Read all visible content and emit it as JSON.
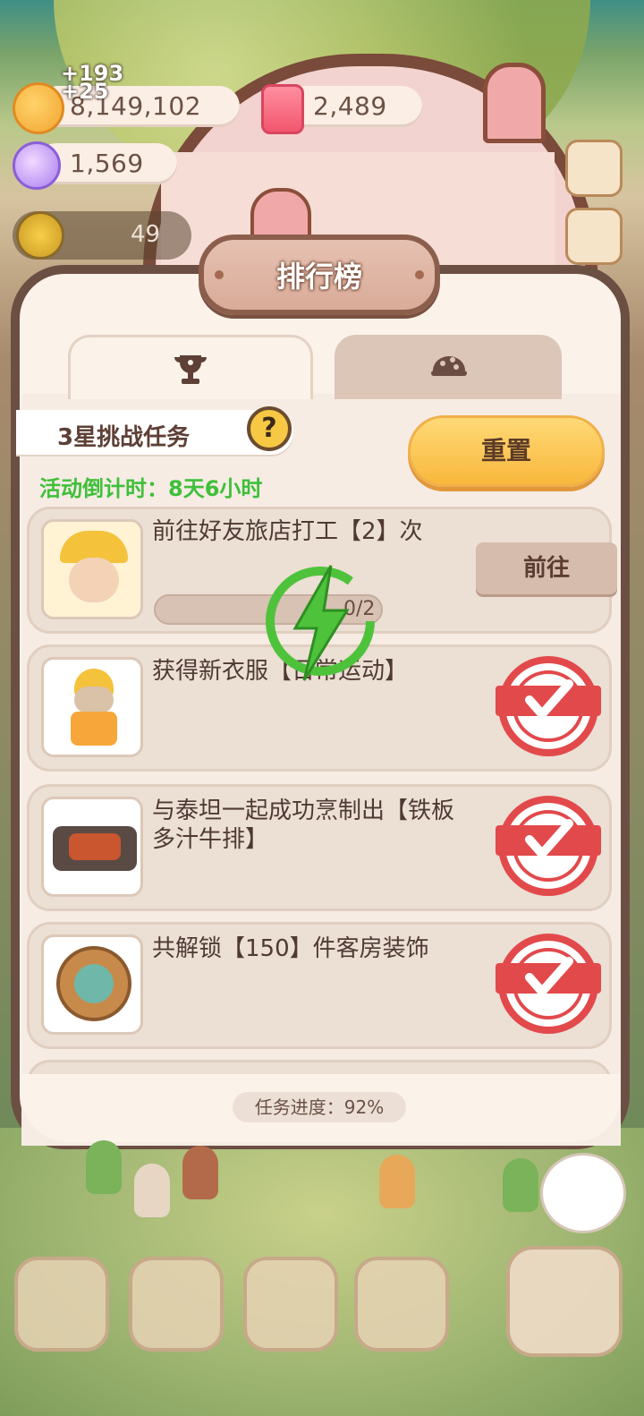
{
  "resources": {
    "cookies": {
      "value": "8,149,102",
      "icon": "cookie-icon"
    },
    "cookie_gain_1": "+193",
    "cookie_gain_2": "+25",
    "candles": {
      "value": "2,489",
      "icon": "candle-icon"
    },
    "gems": {
      "value": "1,569",
      "icon": "gem-icon"
    },
    "level": "49"
  },
  "panel": {
    "title": "排行榜",
    "tabs": [
      {
        "icon": "trophy-icon",
        "active": true
      },
      {
        "icon": "world-icon",
        "active": false
      }
    ],
    "challenge_label": "3星挑战任务",
    "help_label": "?",
    "countdown": "活动倒计时：8天6小时",
    "reset_label": "重置"
  },
  "tasks": [
    {
      "text": "前往好友旅店打工【2】次",
      "status": "in-progress",
      "action": "前往",
      "progress_text": "0/2",
      "progress": 0.0,
      "icon": "worker-icon"
    },
    {
      "text": "获得新衣服【日常运动】",
      "status": "completed",
      "icon": "outfit-icon"
    },
    {
      "text": "与泰坦一起成功烹制出【铁板多汁牛排】",
      "status": "completed",
      "icon": "steak-icon"
    },
    {
      "text": "共解锁【150】件客房装饰",
      "status": "completed",
      "icon": "decoration-icon"
    }
  ],
  "footer": {
    "progress_label": "任务进度：92%"
  },
  "colors": {
    "panel_border": "#6c4f43",
    "panel_bg": "#fbf2ea",
    "countdown_green": "#3fbf3a",
    "reset_yellow": "#f8b83c",
    "stamp_red": "#e2494b"
  }
}
